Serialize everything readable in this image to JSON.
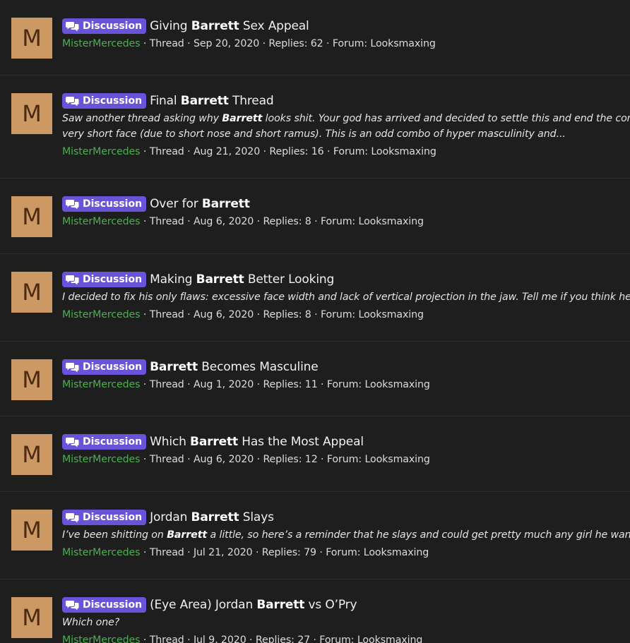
{
  "badge_label": "Discussion",
  "avatar_letter": "M",
  "results": [
    {
      "title_pre": "Giving ",
      "title_bold": "Barrett",
      "title_post": " Sex Appeal",
      "snippet": [],
      "author": "MisterMercedes",
      "type": "Thread",
      "date": "Sep 20, 2020",
      "replies": "Replies: 62",
      "forum": "Forum: Looksmaxing"
    },
    {
      "title_pre": "Final ",
      "title_bold": "Barrett",
      "title_post": " Thread",
      "snippet": [
        {
          "pre": "Saw another thread asking why ",
          "bold": "Barrett",
          "post": " looks shit. Your god has arrived and decided to settle this and end the confusion"
        },
        {
          "pre": "very short face (due to short nose and short ramus). This is an odd combo of hyper masculinity and...",
          "bold": "",
          "post": ""
        }
      ],
      "author": "MisterMercedes",
      "type": "Thread",
      "date": "Aug 21, 2020",
      "replies": "Replies: 16",
      "forum": "Forum: Looksmaxing"
    },
    {
      "title_pre": "Over for ",
      "title_bold": "Barrett",
      "title_post": "",
      "snippet": [],
      "author": "MisterMercedes",
      "type": "Thread",
      "date": "Aug 6, 2020",
      "replies": "Replies: 8",
      "forum": "Forum: Looksmaxing"
    },
    {
      "title_pre": "Making ",
      "title_bold": "Barrett",
      "title_post": " Better Looking",
      "snippet": [
        {
          "pre": "I decided to fix his only flaws: excessive face width and lack of vertical projection in the jaw. Tell me if you think he looks",
          "bold": "",
          "post": ""
        }
      ],
      "author": "MisterMercedes",
      "type": "Thread",
      "date": "Aug 6, 2020",
      "replies": "Replies: 8",
      "forum": "Forum: Looksmaxing"
    },
    {
      "title_pre": "",
      "title_bold": "Barrett",
      "title_post": " Becomes Masculine",
      "snippet": [],
      "author": "MisterMercedes",
      "type": "Thread",
      "date": "Aug 1, 2020",
      "replies": "Replies: 11",
      "forum": "Forum: Looksmaxing"
    },
    {
      "title_pre": "Which ",
      "title_bold": "Barrett",
      "title_post": " Has the Most Appeal",
      "snippet": [],
      "author": "MisterMercedes",
      "type": "Thread",
      "date": "Aug 6, 2020",
      "replies": "Replies: 12",
      "forum": "Forum: Looksmaxing"
    },
    {
      "title_pre": "Jordan ",
      "title_bold": "Barrett",
      "title_post": " Slays",
      "snippet": [
        {
          "pre": "I’ve been shitting on ",
          "bold": "Barrett",
          "post": " a little, so here’s a reminder that he slays and could get pretty much any girl he wants:"
        }
      ],
      "author": "MisterMercedes",
      "type": "Thread",
      "date": "Jul 21, 2020",
      "replies": "Replies: 79",
      "forum": "Forum: Looksmaxing"
    },
    {
      "title_pre": "(Eye Area) Jordan ",
      "title_bold": "Barrett",
      "title_post": " vs O’Pry",
      "snippet": [
        {
          "pre": "Which one?",
          "bold": "",
          "post": ""
        }
      ],
      "author": "MisterMercedes",
      "type": "Thread",
      "date": "Jul 9, 2020",
      "replies": "Replies: 27",
      "forum": "Forum: Looksmaxing"
    }
  ]
}
